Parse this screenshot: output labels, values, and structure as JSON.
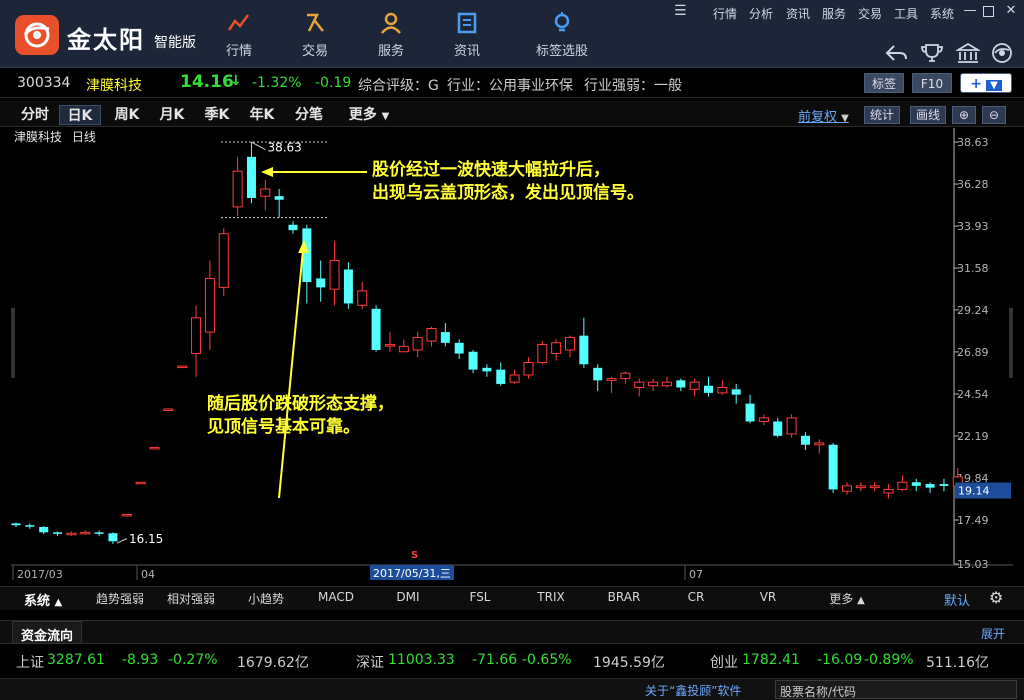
{
  "app": {
    "brand": "金太阳",
    "edition": "智能版"
  },
  "nav": [
    {
      "id": "hangqing",
      "label": "行情"
    },
    {
      "id": "jiaoyi",
      "label": "交易"
    },
    {
      "id": "fuwu",
      "label": "服务"
    },
    {
      "id": "zixun",
      "label": "资讯"
    },
    {
      "id": "biaoqian",
      "label": "标签选股"
    }
  ],
  "menu": [
    "行情",
    "分析",
    "资讯",
    "服务",
    "交易",
    "工具",
    "系统"
  ],
  "stock": {
    "code": "300334",
    "name": "津膜科技",
    "price": "14.16",
    "change_pct": "-1.32%",
    "change": "-0.19",
    "rating": "综合评级：G",
    "industry": "行业：公用事业环保",
    "strength": "行业强弱：一般",
    "btn_tag": "标签",
    "btn_f10": "F10"
  },
  "periods": [
    "分时",
    "日K",
    "周K",
    "月K",
    "季K",
    "年K",
    "分笔",
    "更多"
  ],
  "active_period": "日K",
  "right_tools": {
    "fq": "前复权",
    "stat": "统计",
    "draw": "画线"
  },
  "chart_header": {
    "name": "津膜科技",
    "period": "日线"
  },
  "chart_data": {
    "type": "candlestick",
    "y_ticks": [
      "38.63",
      "36.28",
      "33.93",
      "31.58",
      "29.24",
      "26.89",
      "24.54",
      "22.19",
      "19.84",
      "17.49",
      "15.03"
    ],
    "x_labels": [
      "2017/03",
      "04",
      "07"
    ],
    "highlight_date": "2017/05/31,三",
    "last_price_label": "19.14",
    "high_label": "38.63",
    "low_label": "16.15",
    "colors": {
      "up": "#ff3c3c",
      "down": "#54ffff",
      "axis": "#b4b4b4",
      "grid": "#1e1e1e"
    },
    "candles": [
      [
        17.3,
        17.2,
        17.35,
        17.1
      ],
      [
        17.2,
        17.15,
        17.3,
        17.0
      ],
      [
        17.1,
        16.8,
        17.15,
        16.7
      ],
      [
        16.8,
        16.75,
        16.85,
        16.6
      ],
      [
        16.7,
        16.75,
        16.85,
        16.6
      ],
      [
        16.75,
        16.8,
        16.9,
        16.65
      ],
      [
        16.8,
        16.75,
        16.9,
        16.6
      ],
      [
        16.75,
        16.3,
        16.8,
        16.15
      ],
      [
        17.8,
        17.8,
        17.8,
        17.8
      ],
      [
        19.6,
        19.6,
        19.6,
        19.6
      ],
      [
        21.55,
        21.55,
        21.55,
        21.55
      ],
      [
        23.7,
        23.7,
        23.7,
        23.7
      ],
      [
        26.1,
        26.1,
        26.1,
        26.1
      ],
      [
        26.8,
        28.8,
        29.5,
        25.5
      ],
      [
        28.0,
        31.0,
        32.0,
        27.0
      ],
      [
        30.5,
        33.5,
        33.8,
        30.0
      ],
      [
        35.0,
        37.0,
        37.8,
        34.5
      ],
      [
        37.8,
        35.5,
        38.63,
        35.2
      ],
      [
        35.6,
        36.0,
        36.5,
        34.8
      ],
      [
        35.6,
        35.4,
        36.0,
        34.4
      ],
      [
        34.0,
        33.7,
        34.2,
        33.5
      ],
      [
        33.8,
        30.8,
        34.0,
        29.6
      ],
      [
        31.0,
        30.5,
        32.0,
        29.7
      ],
      [
        30.4,
        32.0,
        33.1,
        29.5
      ],
      [
        31.5,
        29.6,
        31.9,
        29.3
      ],
      [
        29.5,
        30.3,
        30.8,
        29.3
      ],
      [
        29.3,
        27.0,
        29.5,
        26.9
      ],
      [
        27.3,
        27.3,
        28.0,
        26.9
      ],
      [
        26.9,
        27.2,
        27.6,
        26.9
      ],
      [
        27.0,
        27.7,
        28.0,
        26.6
      ],
      [
        27.5,
        28.2,
        28.3,
        27.2
      ],
      [
        28.0,
        27.4,
        28.5,
        27.2
      ],
      [
        27.4,
        26.8,
        27.6,
        26.5
      ],
      [
        26.9,
        25.9,
        27.0,
        25.7
      ],
      [
        26.0,
        25.8,
        26.2,
        25.5
      ],
      [
        25.9,
        25.1,
        26.3,
        25.0
      ],
      [
        25.2,
        25.6,
        25.9,
        25.1
      ],
      [
        25.6,
        26.3,
        26.6,
        25.4
      ],
      [
        26.3,
        27.3,
        27.5,
        26.2
      ],
      [
        26.8,
        27.4,
        27.6,
        26.4
      ],
      [
        27.0,
        27.7,
        27.8,
        26.6
      ],
      [
        27.8,
        26.2,
        28.8,
        26.0
      ],
      [
        26.0,
        25.3,
        26.2,
        24.7
      ],
      [
        25.3,
        25.4,
        25.5,
        24.6
      ],
      [
        25.4,
        25.7,
        25.8,
        25.1
      ],
      [
        24.9,
        25.2,
        25.4,
        24.4
      ],
      [
        25.0,
        25.2,
        25.4,
        24.7
      ],
      [
        25.0,
        25.2,
        25.5,
        24.9
      ],
      [
        25.3,
        24.9,
        25.4,
        24.7
      ],
      [
        24.8,
        25.2,
        25.4,
        24.4
      ],
      [
        25.0,
        24.6,
        25.5,
        24.4
      ],
      [
        24.6,
        24.9,
        25.3,
        24.5
      ],
      [
        24.8,
        24.5,
        25.1,
        24.0
      ],
      [
        24.0,
        23.0,
        24.5,
        22.9
      ],
      [
        23.0,
        23.2,
        23.4,
        22.8
      ],
      [
        23.0,
        22.2,
        23.2,
        22.1
      ],
      [
        22.3,
        23.2,
        23.4,
        22.1
      ],
      [
        22.2,
        21.7,
        22.4,
        21.4
      ],
      [
        21.7,
        21.8,
        22.0,
        21.2
      ],
      [
        21.7,
        19.2,
        21.8,
        19.0
      ],
      [
        19.1,
        19.4,
        19.6,
        18.9
      ],
      [
        19.3,
        19.4,
        19.6,
        19.1
      ],
      [
        19.3,
        19.4,
        19.6,
        19.1
      ],
      [
        19.0,
        19.2,
        19.5,
        18.7
      ],
      [
        19.2,
        19.6,
        20.0,
        19.1
      ],
      [
        19.6,
        19.4,
        19.8,
        19.1
      ],
      [
        19.5,
        19.3,
        19.6,
        19.0
      ],
      [
        19.5,
        19.4,
        19.8,
        19.1
      ],
      [
        19.4,
        19.9,
        20.4,
        19.3
      ]
    ]
  },
  "annotations": {
    "top": [
      "股价经过一波快速大幅拉升后，",
      "出现乌云盖顶形态，发出见顶信号。"
    ],
    "bottom": [
      "随后股价跌破形态支撑，",
      "见顶信号基本可靠。"
    ]
  },
  "indicators": {
    "system": "系统",
    "items": [
      "趋势强弱",
      "相对强弱",
      "小趋势",
      "MACD",
      "DMI",
      "FSL",
      "TRIX",
      "BRAR",
      "CR",
      "VR",
      "更多"
    ],
    "default": "默认"
  },
  "flow": {
    "title": "资金流向",
    "expand": "展开"
  },
  "indices": [
    {
      "name": "上证",
      "value": "3287.61",
      "change": "-8.93",
      "pct": "-0.27%",
      "amount": "1679.62亿"
    },
    {
      "name": "深证",
      "value": "11003.33",
      "change": "-71.66",
      "pct": "-0.65%",
      "amount": "1945.59亿"
    },
    {
      "name": "创业",
      "value": "1782.41",
      "change": "-16.09",
      "pct": "-0.89%",
      "amount": "511.16亿"
    }
  ],
  "status": {
    "about": "关于“鑫投顾”软件",
    "search": "股票名称/代码"
  }
}
